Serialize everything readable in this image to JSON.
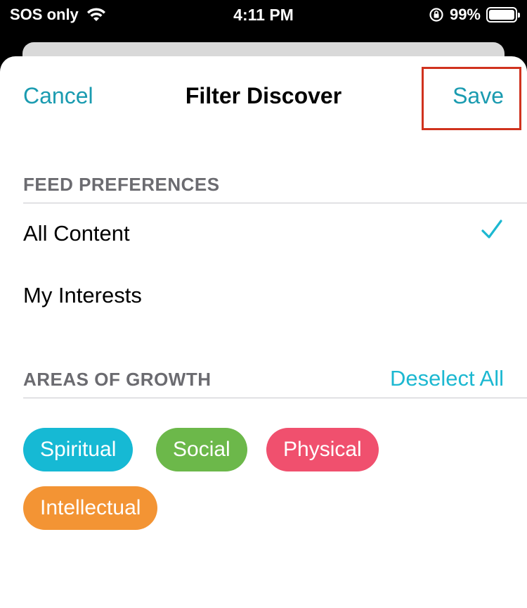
{
  "status_bar": {
    "carrier": "SOS only",
    "time": "4:11 PM",
    "battery": "99%",
    "battery_level": 0.99
  },
  "nav": {
    "cancel_label": "Cancel",
    "title": "Filter Discover",
    "save_label": "Save"
  },
  "feed_preferences": {
    "header": "FEED PREFERENCES",
    "options": [
      {
        "label": "All Content",
        "selected": true
      },
      {
        "label": "My Interests",
        "selected": false
      }
    ]
  },
  "areas_of_growth": {
    "header": "AREAS OF GROWTH",
    "deselect_label": "Deselect All",
    "chips": [
      {
        "label": "Spiritual",
        "color": "#16b9d4"
      },
      {
        "label": "Social",
        "color": "#6cb84a"
      },
      {
        "label": "Physical",
        "color": "#f0506e"
      },
      {
        "label": "Intellectual",
        "color": "#f39434"
      }
    ]
  },
  "colors": {
    "accent": "#1a9bb0",
    "highlight_box": "#d0321e"
  }
}
